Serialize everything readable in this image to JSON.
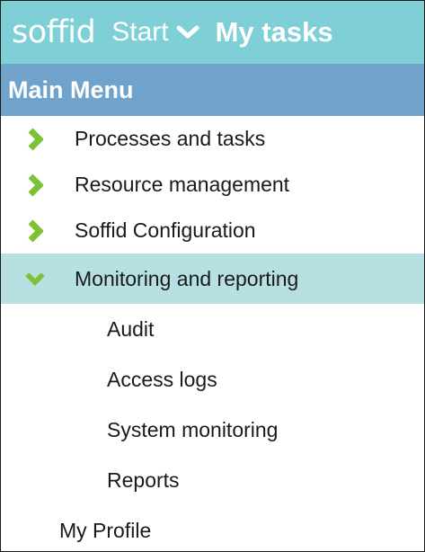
{
  "header": {
    "logo": "soffid",
    "start_label": "Start",
    "title": "My tasks"
  },
  "menu": {
    "title": "Main Menu",
    "items": [
      {
        "label": "Processes and tasks",
        "icon": "chevron-right-icon"
      },
      {
        "label": "Resource management",
        "icon": "chevron-right-icon"
      },
      {
        "label": "Soffid Configuration",
        "icon": "chevron-right-icon"
      },
      {
        "label": "Monitoring and reporting",
        "icon": "chevron-down-icon",
        "expanded": true,
        "children": [
          "Audit",
          "Access logs",
          "System monitoring",
          "Reports"
        ]
      }
    ],
    "profile": "My Profile"
  },
  "colors": {
    "topbar": "#7fd0d6",
    "menu_header": "#6fa3cc",
    "expanded_row": "#b7e0e3",
    "chevron": "#7cc234"
  }
}
